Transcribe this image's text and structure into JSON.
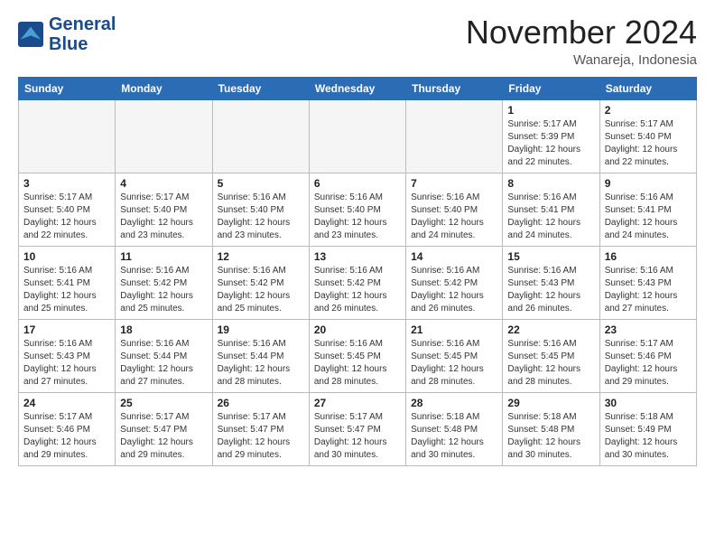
{
  "logo": {
    "line1": "General",
    "line2": "Blue"
  },
  "header": {
    "month": "November 2024",
    "location": "Wanareja, Indonesia"
  },
  "weekdays": [
    "Sunday",
    "Monday",
    "Tuesday",
    "Wednesday",
    "Thursday",
    "Friday",
    "Saturday"
  ],
  "weeks": [
    [
      {
        "day": "",
        "info": ""
      },
      {
        "day": "",
        "info": ""
      },
      {
        "day": "",
        "info": ""
      },
      {
        "day": "",
        "info": ""
      },
      {
        "day": "",
        "info": ""
      },
      {
        "day": "1",
        "info": "Sunrise: 5:17 AM\nSunset: 5:39 PM\nDaylight: 12 hours and 22 minutes."
      },
      {
        "day": "2",
        "info": "Sunrise: 5:17 AM\nSunset: 5:40 PM\nDaylight: 12 hours and 22 minutes."
      }
    ],
    [
      {
        "day": "3",
        "info": "Sunrise: 5:17 AM\nSunset: 5:40 PM\nDaylight: 12 hours and 22 minutes."
      },
      {
        "day": "4",
        "info": "Sunrise: 5:17 AM\nSunset: 5:40 PM\nDaylight: 12 hours and 23 minutes."
      },
      {
        "day": "5",
        "info": "Sunrise: 5:16 AM\nSunset: 5:40 PM\nDaylight: 12 hours and 23 minutes."
      },
      {
        "day": "6",
        "info": "Sunrise: 5:16 AM\nSunset: 5:40 PM\nDaylight: 12 hours and 23 minutes."
      },
      {
        "day": "7",
        "info": "Sunrise: 5:16 AM\nSunset: 5:40 PM\nDaylight: 12 hours and 24 minutes."
      },
      {
        "day": "8",
        "info": "Sunrise: 5:16 AM\nSunset: 5:41 PM\nDaylight: 12 hours and 24 minutes."
      },
      {
        "day": "9",
        "info": "Sunrise: 5:16 AM\nSunset: 5:41 PM\nDaylight: 12 hours and 24 minutes."
      }
    ],
    [
      {
        "day": "10",
        "info": "Sunrise: 5:16 AM\nSunset: 5:41 PM\nDaylight: 12 hours and 25 minutes."
      },
      {
        "day": "11",
        "info": "Sunrise: 5:16 AM\nSunset: 5:42 PM\nDaylight: 12 hours and 25 minutes."
      },
      {
        "day": "12",
        "info": "Sunrise: 5:16 AM\nSunset: 5:42 PM\nDaylight: 12 hours and 25 minutes."
      },
      {
        "day": "13",
        "info": "Sunrise: 5:16 AM\nSunset: 5:42 PM\nDaylight: 12 hours and 26 minutes."
      },
      {
        "day": "14",
        "info": "Sunrise: 5:16 AM\nSunset: 5:42 PM\nDaylight: 12 hours and 26 minutes."
      },
      {
        "day": "15",
        "info": "Sunrise: 5:16 AM\nSunset: 5:43 PM\nDaylight: 12 hours and 26 minutes."
      },
      {
        "day": "16",
        "info": "Sunrise: 5:16 AM\nSunset: 5:43 PM\nDaylight: 12 hours and 27 minutes."
      }
    ],
    [
      {
        "day": "17",
        "info": "Sunrise: 5:16 AM\nSunset: 5:43 PM\nDaylight: 12 hours and 27 minutes."
      },
      {
        "day": "18",
        "info": "Sunrise: 5:16 AM\nSunset: 5:44 PM\nDaylight: 12 hours and 27 minutes."
      },
      {
        "day": "19",
        "info": "Sunrise: 5:16 AM\nSunset: 5:44 PM\nDaylight: 12 hours and 28 minutes."
      },
      {
        "day": "20",
        "info": "Sunrise: 5:16 AM\nSunset: 5:45 PM\nDaylight: 12 hours and 28 minutes."
      },
      {
        "day": "21",
        "info": "Sunrise: 5:16 AM\nSunset: 5:45 PM\nDaylight: 12 hours and 28 minutes."
      },
      {
        "day": "22",
        "info": "Sunrise: 5:16 AM\nSunset: 5:45 PM\nDaylight: 12 hours and 28 minutes."
      },
      {
        "day": "23",
        "info": "Sunrise: 5:17 AM\nSunset: 5:46 PM\nDaylight: 12 hours and 29 minutes."
      }
    ],
    [
      {
        "day": "24",
        "info": "Sunrise: 5:17 AM\nSunset: 5:46 PM\nDaylight: 12 hours and 29 minutes."
      },
      {
        "day": "25",
        "info": "Sunrise: 5:17 AM\nSunset: 5:47 PM\nDaylight: 12 hours and 29 minutes."
      },
      {
        "day": "26",
        "info": "Sunrise: 5:17 AM\nSunset: 5:47 PM\nDaylight: 12 hours and 29 minutes."
      },
      {
        "day": "27",
        "info": "Sunrise: 5:17 AM\nSunset: 5:47 PM\nDaylight: 12 hours and 30 minutes."
      },
      {
        "day": "28",
        "info": "Sunrise: 5:18 AM\nSunset: 5:48 PM\nDaylight: 12 hours and 30 minutes."
      },
      {
        "day": "29",
        "info": "Sunrise: 5:18 AM\nSunset: 5:48 PM\nDaylight: 12 hours and 30 minutes."
      },
      {
        "day": "30",
        "info": "Sunrise: 5:18 AM\nSunset: 5:49 PM\nDaylight: 12 hours and 30 minutes."
      }
    ]
  ]
}
